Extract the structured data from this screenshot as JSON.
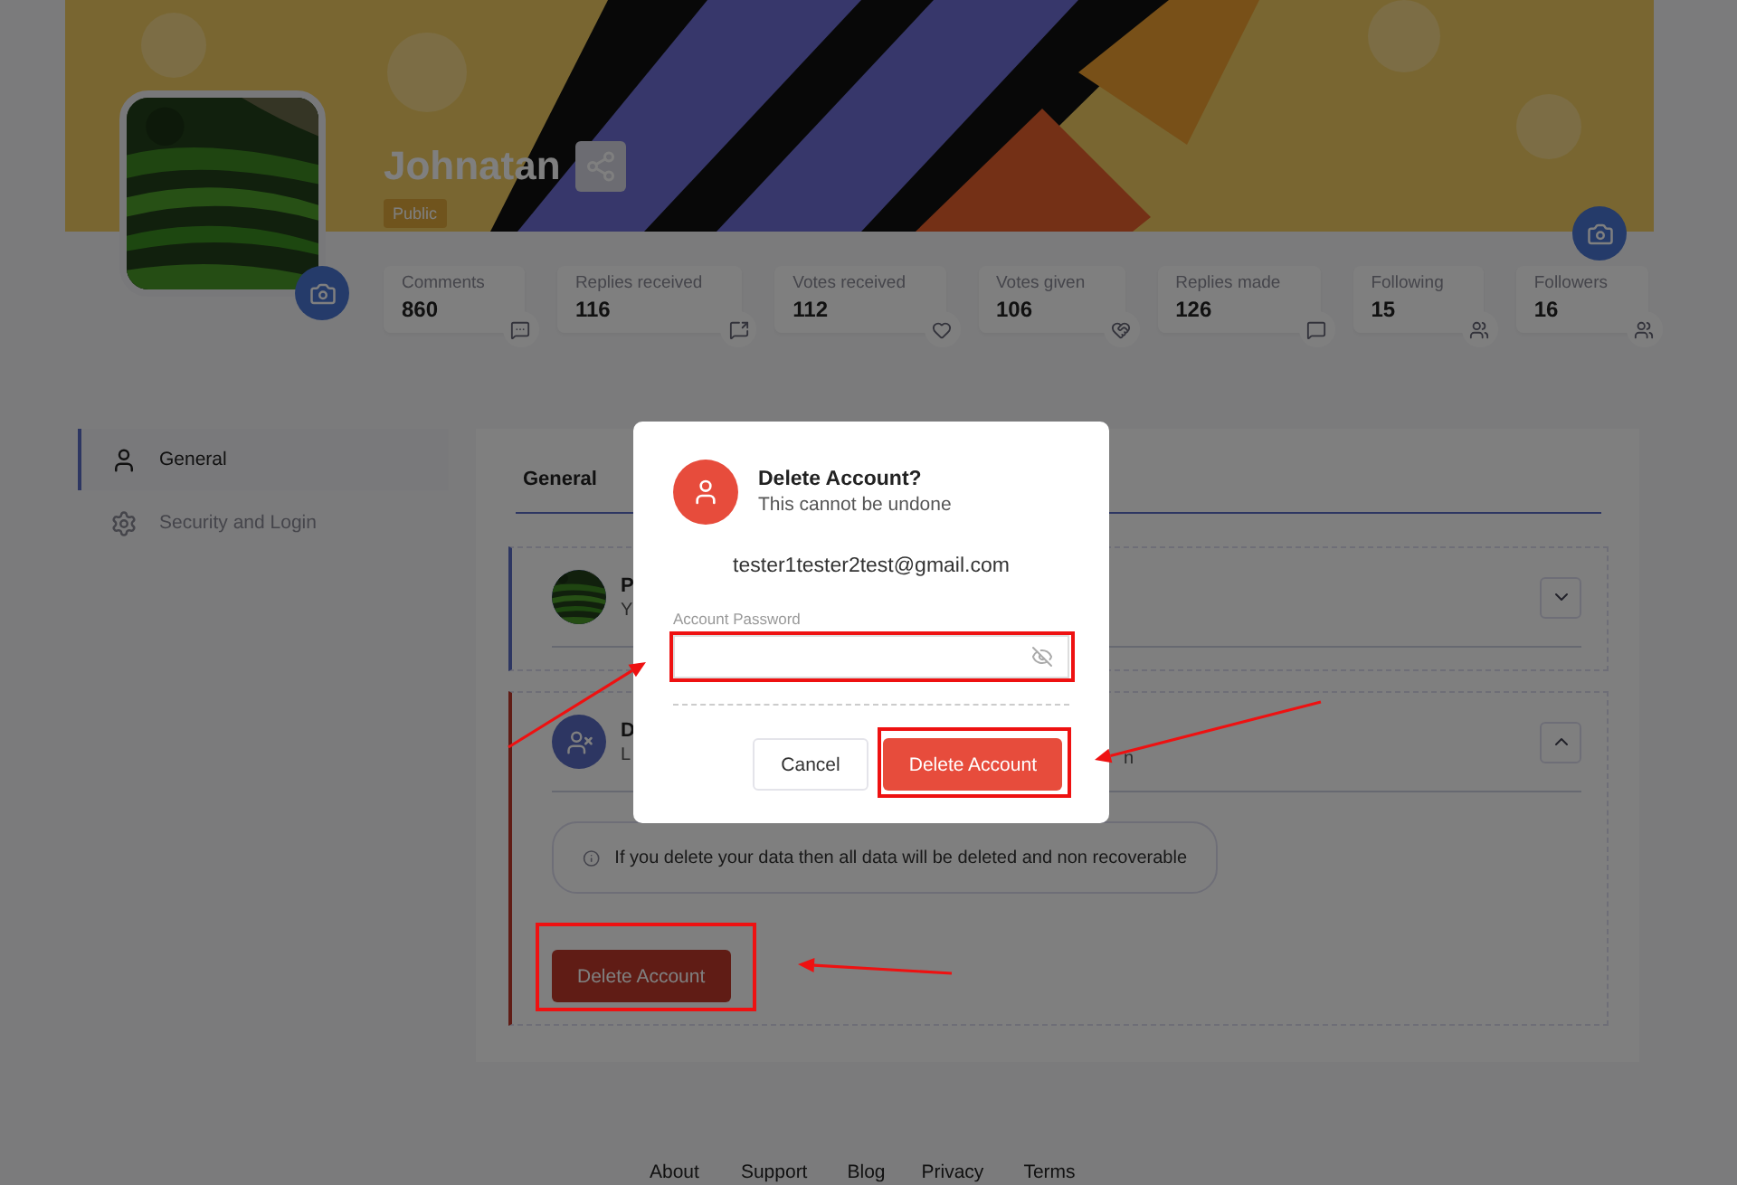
{
  "profile": {
    "name": "Johnatan",
    "visibility": "Public"
  },
  "stats": [
    {
      "label": "Comments",
      "value": "860"
    },
    {
      "label": "Replies received",
      "value": "116"
    },
    {
      "label": "Votes received",
      "value": "112"
    },
    {
      "label": "Votes given",
      "value": "106"
    },
    {
      "label": "Replies made",
      "value": "126"
    },
    {
      "label": "Following",
      "value": "15"
    },
    {
      "label": "Followers",
      "value": "16"
    }
  ],
  "sidebar": {
    "items": [
      {
        "label": "General",
        "selected": true
      },
      {
        "label": "Security and Login",
        "selected": false
      }
    ]
  },
  "main": {
    "title": "General",
    "sections": [
      {
        "title": "P",
        "subtitle": "Y",
        "kind": "info",
        "expanded": false
      },
      {
        "title": "D",
        "subtitle": "L",
        "trailing": "n",
        "kind": "danger",
        "expanded": true,
        "notice": "If you delete your data then all data will be deleted and non recoverable",
        "button": "Delete Account"
      }
    ]
  },
  "modal": {
    "title": "Delete Account?",
    "subtitle": "This cannot be undone",
    "email": "tester1tester2test@gmail.com",
    "password_label": "Account Password",
    "buttons": [
      {
        "label": "Cancel",
        "kind": "secondary"
      },
      {
        "label": "Delete Account",
        "kind": "danger"
      }
    ]
  },
  "footer": {
    "links": [
      "About",
      "Support",
      "Blog",
      "Privacy",
      "Terms"
    ]
  }
}
